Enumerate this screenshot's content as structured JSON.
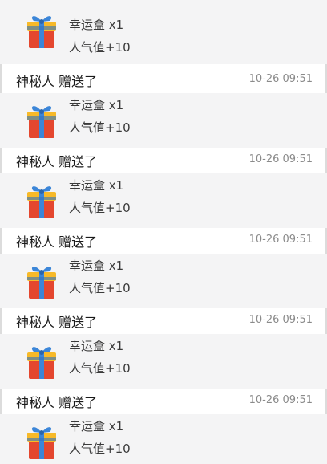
{
  "colors": {
    "card_bg": "#f4f4f5",
    "text_primary": "#1b1b1b",
    "text_secondary": "#3a3a3a",
    "time_text": "#8a8a8a",
    "gift_box_red": "#e4472f",
    "gift_ribbon_blue": "#3c86d8",
    "gift_lid_yellow": "#f7b928"
  },
  "top_gift": {
    "icon": "gift-box-icon",
    "name": "幸运盒 x1",
    "popularity": "人气值+10"
  },
  "entries": [
    {
      "sender": "神秘人 赠送了",
      "time": "10-26 09:51",
      "icon": "gift-box-icon",
      "gift_name": "幸运盒 x1",
      "popularity": "人气值+10"
    },
    {
      "sender": "神秘人 赠送了",
      "time": "10-26 09:51",
      "icon": "gift-box-icon",
      "gift_name": "幸运盒 x1",
      "popularity": "人气值+10"
    },
    {
      "sender": "神秘人 赠送了",
      "time": "10-26 09:51",
      "icon": "gift-box-icon",
      "gift_name": "幸运盒 x1",
      "popularity": "人气值+10"
    },
    {
      "sender": "神秘人 赠送了",
      "time": "10-26 09:51",
      "icon": "gift-box-icon",
      "gift_name": "幸运盒 x1",
      "popularity": "人气值+10"
    },
    {
      "sender": "神秘人 赠送了",
      "time": "10-26 09:51",
      "icon": "gift-box-icon",
      "gift_name": "幸运盒 x1",
      "popularity": "人气值+10"
    }
  ]
}
